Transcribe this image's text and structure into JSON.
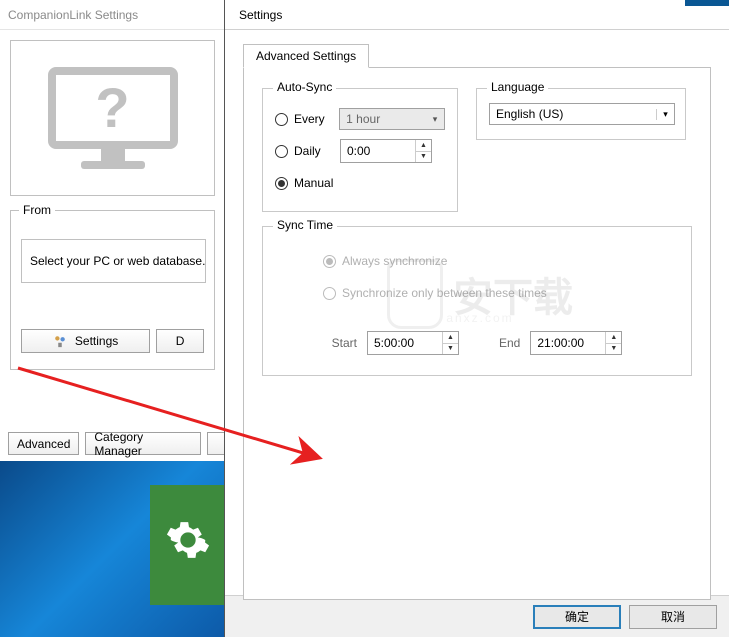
{
  "back_window": {
    "title": "CompanionLink Settings",
    "from_label": "From",
    "from_text": "Select your PC or web database.",
    "settings_btn": "Settings",
    "d_btn": "D",
    "advanced_btn": "Advanced",
    "category_btn": "Category Manager"
  },
  "dialog": {
    "title": "Settings",
    "tab_label": "Advanced Settings",
    "autosync": {
      "legend": "Auto-Sync",
      "every_label": "Every",
      "every_value": "1 hour",
      "daily_label": "Daily",
      "daily_value": "0:00",
      "manual_label": "Manual"
    },
    "language": {
      "legend": "Language",
      "value": "English (US)"
    },
    "synctime": {
      "legend": "Sync Time",
      "always_label": "Always synchronize",
      "between_label": "Synchronize only between these times",
      "start_label": "Start",
      "start_value": "5:00:00",
      "end_label": "End",
      "end_value": "21:00:00"
    },
    "ok_btn": "确定",
    "cancel_btn": "取消"
  },
  "watermark": {
    "main": "安下载",
    "sub": "anxz.com"
  }
}
